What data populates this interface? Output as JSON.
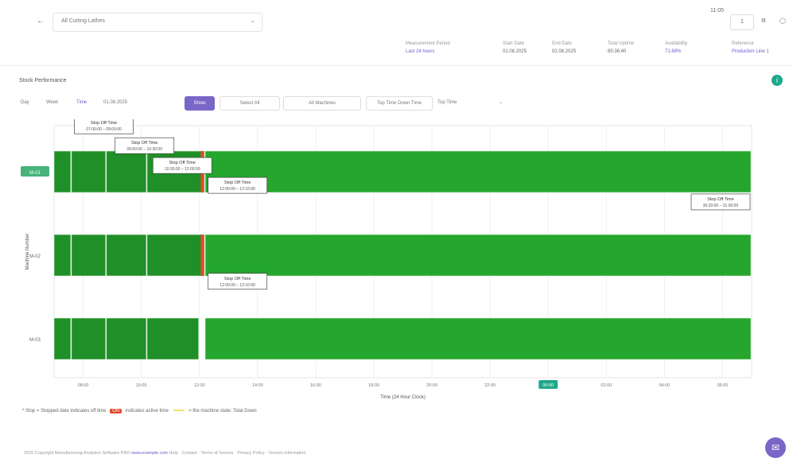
{
  "header": {
    "back_icon": "arrow-left-icon",
    "selector_text": "All Cutting Lathes",
    "clock": "11:05",
    "btn_a": "1",
    "metrics": [
      {
        "key": "Measurement Period",
        "value": "Last 24 hours",
        "link": true
      },
      {
        "key": "Start Date",
        "value": "01.08.2025",
        "link": false
      },
      {
        "key": "End Date",
        "value": "02.08.2025",
        "link": false
      },
      {
        "key": "Total Uptime",
        "value": "85:36:40",
        "link": false
      },
      {
        "key": "Availability",
        "value": "71.69%",
        "link": true
      },
      {
        "key": "Reference",
        "value": "Production Line 1",
        "link": true
      }
    ]
  },
  "panel": {
    "title": "Stock Performance",
    "controls": {
      "day": "Day",
      "week": "Week",
      "time": "Time",
      "date_value": "01.08.2025",
      "apply": "Show",
      "filter1": "Select All",
      "filter2": "All Machines",
      "filter3": "Top Time Down Time",
      "filter4": "Top Time"
    }
  },
  "colors": {
    "running": "#25a62c",
    "running_dark": "#1f8f27",
    "stop": "#e24b2a",
    "accent": "#7a66c7",
    "teal": "#1fa88a"
  },
  "chart_data": {
    "type": "timeline",
    "xlabel": "Time (24 Hour Clock)",
    "ylabel": "Machine Number",
    "x_ticks": [
      "08:00",
      "10:00",
      "12:00",
      "14:00",
      "16:00",
      "18:00",
      "20:00",
      "22:00",
      "00:00",
      "02:00",
      "04:00",
      "06:00"
    ],
    "x_range": [
      7,
      31
    ],
    "highlight_tick": "00:00",
    "rows": [
      {
        "name": "M-01",
        "segments": [
          [
            7.0,
            7.6,
            "dark"
          ],
          [
            7.6,
            8.8,
            "dark"
          ],
          [
            8.8,
            10.2,
            "dark"
          ],
          [
            10.2,
            12.2,
            "dark"
          ],
          [
            12.2,
            31.0,
            "run"
          ]
        ]
      },
      {
        "name": "M-02",
        "segments": [
          [
            7.0,
            7.6,
            "dark"
          ],
          [
            7.6,
            8.8,
            "dark"
          ],
          [
            8.8,
            10.2,
            "dark"
          ],
          [
            10.2,
            12.2,
            "dark"
          ],
          [
            12.2,
            31.0,
            "run"
          ]
        ]
      },
      {
        "name": "M-03",
        "segments": [
          [
            7.0,
            7.6,
            "dark"
          ],
          [
            7.6,
            8.8,
            "dark"
          ],
          [
            8.8,
            10.2,
            "dark"
          ],
          [
            10.2,
            12.0,
            "dark"
          ],
          [
            12.2,
            31.0,
            "run"
          ]
        ]
      }
    ],
    "stop_markers": [
      {
        "x": 12.1,
        "rows": [
          0,
          1
        ]
      }
    ],
    "annotations": [
      {
        "label": "Stop Off Time",
        "range": "07:00:00 – 09:00:00",
        "x": 7.7,
        "row_offset": -0.55
      },
      {
        "label": "Stop Off Time",
        "range": "09:00:00 – 10:30:00",
        "x": 9.1,
        "row_offset": -0.25
      },
      {
        "label": "Stop Off Time",
        "range": "10:30:00 – 12:00:00",
        "x": 10.4,
        "row_offset": 0.05
      },
      {
        "label": "Stop Off Time",
        "range": "12:00:00 – 12:10:00",
        "x": 12.3,
        "row_offset": 0.35
      },
      {
        "label": "Stop Off Time",
        "range": "12:00:00 – 12:10:00",
        "x": 12.3,
        "row_offset": 1.8
      },
      {
        "label": "Stop Off Time",
        "range": "30:20:00 – 31:00:00",
        "x": 30.4,
        "row_offset": 0.6
      }
    ]
  },
  "legend": {
    "text1": "* Stop = Stopped date indicates off time",
    "badge": "ON",
    "text2": "indicates active time",
    "text3": "= the machine state: Total Down"
  },
  "footer": {
    "text": "2025 Copyright Manufacturing Analytics Software PRO",
    "link": "www.example.com",
    "rest": "Help · Contact · Terms of Service · Privacy Policy · Version information"
  },
  "fab_icon": "chat-icon"
}
